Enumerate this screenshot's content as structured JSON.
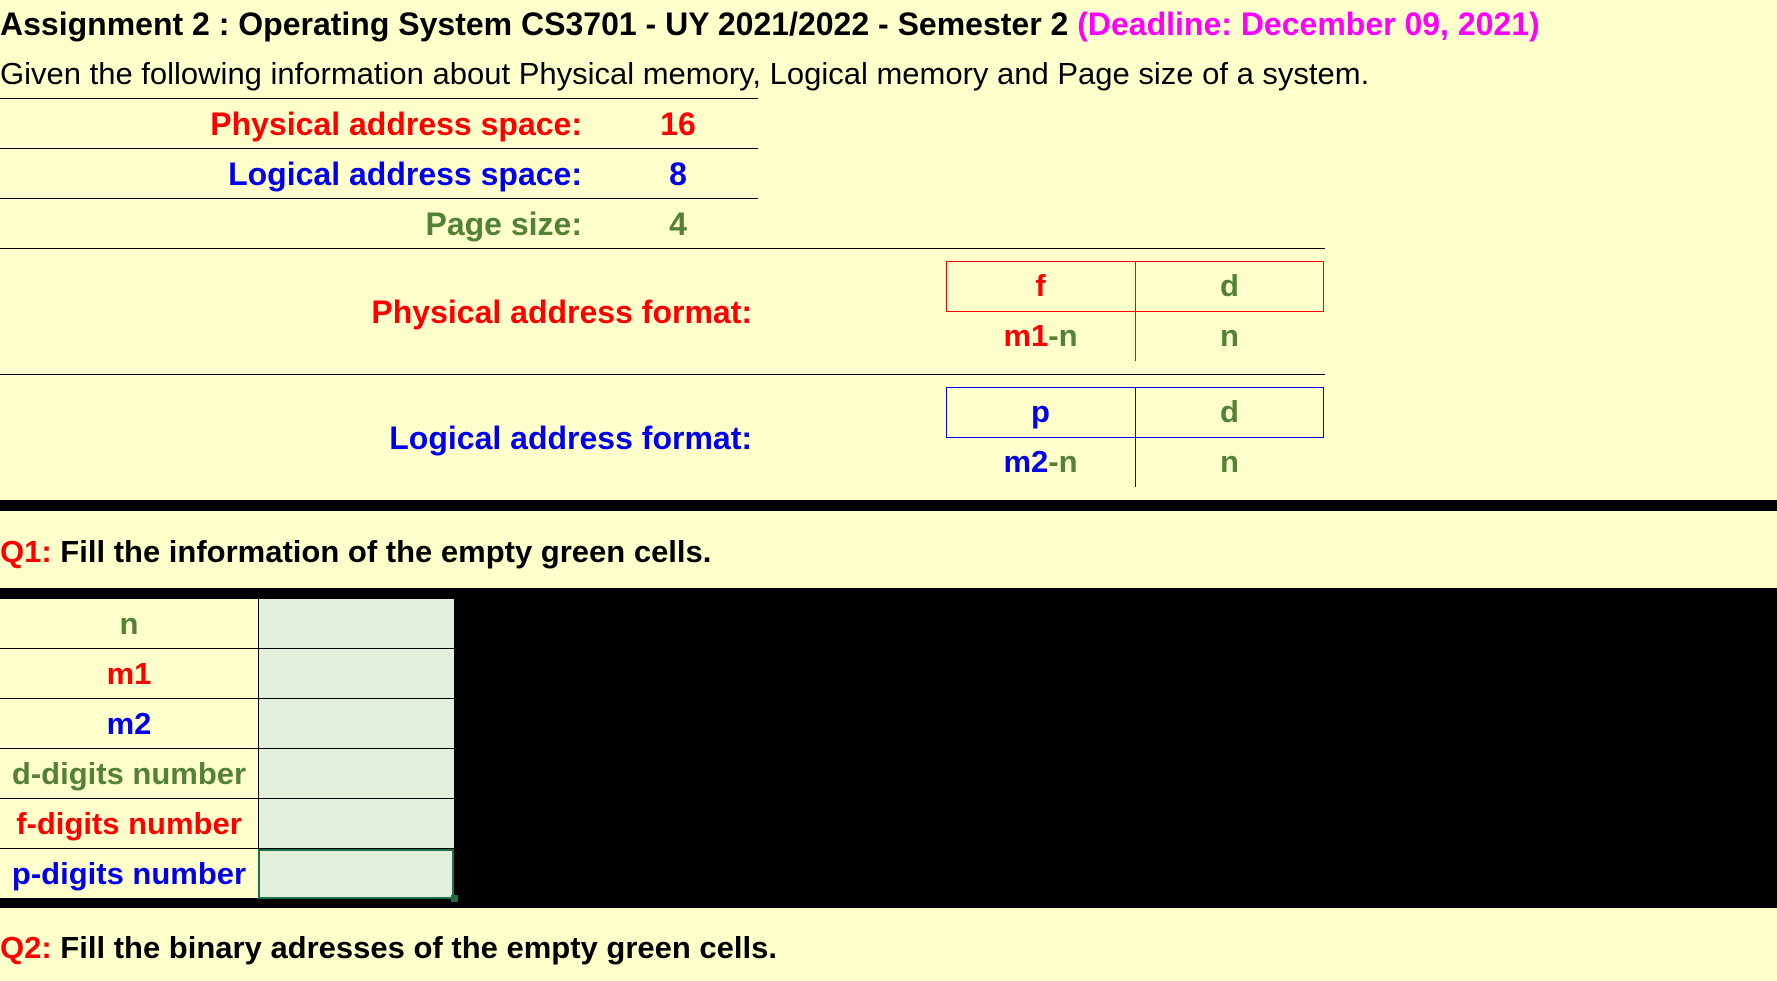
{
  "header": {
    "title": "Assignment 2 : Operating System CS3701 - UY 2021/2022 - Semester 2",
    "deadline": "(Deadline: December 09, 2021)",
    "intro": "Given the following information about Physical memory, Logical memory and Page size of a system."
  },
  "params": [
    {
      "label": "Physical address space:",
      "value": "16",
      "color": "#ff0000"
    },
    {
      "label": "Logical address space:",
      "value": "8",
      "color": "#0000ee"
    },
    {
      "label": "Page size:",
      "value": "4",
      "color": "#548235"
    }
  ],
  "physical_format": {
    "label": "Physical address format:",
    "top": [
      "f",
      "d"
    ],
    "bottom_left_a": "m1",
    "bottom_left_b": "-n",
    "bottom_right": "n",
    "border_color": "#ff0000"
  },
  "logical_format": {
    "label": "Logical address format:",
    "top": [
      "p",
      "d"
    ],
    "bottom_left_a": "m2",
    "bottom_left_b": "-n",
    "bottom_right": "n",
    "border_color": "#0000ee"
  },
  "q1": {
    "number": "Q1:",
    "text": " Fill the information of the empty green cells.",
    "rows": [
      {
        "label": "n",
        "color": "#548235",
        "value": ""
      },
      {
        "label": "m1",
        "color": "#ff0000",
        "value": ""
      },
      {
        "label": "m2",
        "color": "#0000ee",
        "value": ""
      },
      {
        "label": "d-digits number",
        "color": "#548235",
        "value": ""
      },
      {
        "label": "f-digits number",
        "color": "#ff0000",
        "value": ""
      },
      {
        "label": "p-digits number",
        "color": "#0000ee",
        "value": ""
      }
    ]
  },
  "q2": {
    "number": "Q2:",
    "text": " Fill the binary adresses of the empty green cells."
  }
}
